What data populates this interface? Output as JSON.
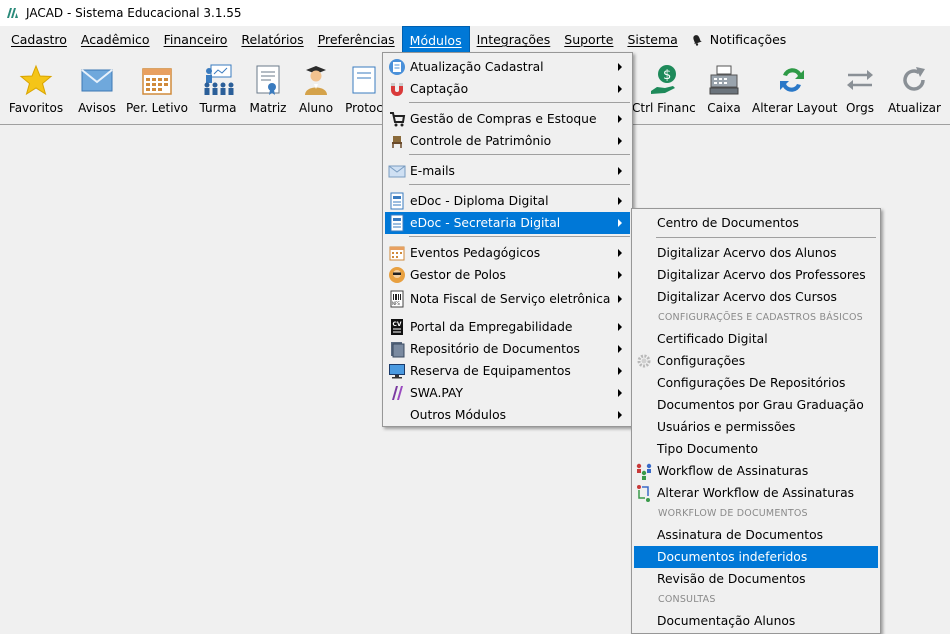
{
  "window": {
    "title": "JACAD - Sistema Educacional 3.1.55"
  },
  "menubar": {
    "items": [
      "Cadastro",
      "Acadêmico",
      "Financeiro",
      "Relatórios",
      "Preferências",
      "Módulos",
      "Integrações",
      "Suporte",
      "Sistema"
    ],
    "notifications_label": "Notificações"
  },
  "toolbar": {
    "favoritos": "Favoritos",
    "avisos": "Avisos",
    "per_letivo": "Per. Letivo",
    "turma": "Turma",
    "matriz": "Matriz",
    "aluno": "Aluno",
    "protocolo": "Protoc",
    "ctrl_financ": "Ctrl Financ.",
    "caixa": "Caixa",
    "alterar_layout": "Alterar Layout",
    "orgs": "Orgs",
    "atualizar": "Atualizar"
  },
  "modulos_menu": {
    "items": [
      "Atualização Cadastral",
      "Captação",
      "Gestão de Compras e Estoque",
      "Controle de Patrimônio",
      "E-mails",
      "eDoc - Diploma Digital",
      "eDoc - Secretaria Digital",
      "Eventos Pedagógicos",
      "Gestor de Polos",
      "Nota Fiscal de Serviço eletrônica",
      "Portal da Empregabilidade",
      "Repositório de Documentos",
      "Reserva de Equipamentos",
      "SWA.PAY",
      "Outros Módulos"
    ],
    "selected": "eDoc - Secretaria Digital"
  },
  "secretaria_submenu": {
    "items": [
      "Centro de Documentos",
      "Digitalizar Acervo dos Alunos",
      "Digitalizar Acervo dos Professores",
      "Digitalizar Acervo dos Cursos",
      "Certificado Digital",
      "Configurações",
      "Configurações De Repositórios",
      "Documentos por Grau Graduação",
      "Usuários e permissões",
      "Tipo Documento",
      "Workflow de Assinaturas",
      "Alterar Workflow de Assinaturas",
      "Assinatura de Documentos",
      "Documentos indeferidos",
      "Revisão de Documentos",
      "Documentação Alunos"
    ],
    "headers": [
      "CONFIGURAÇÕES E CADASTROS BÁSICOS",
      "WORKFLOW DE DOCUMENTOS",
      "CONSULTAS"
    ],
    "selected": "Documentos indeferidos"
  },
  "colors": {
    "selection": "#0078d7",
    "menu_bg": "#f0f0f0",
    "header_text": "#8a8a8a"
  }
}
